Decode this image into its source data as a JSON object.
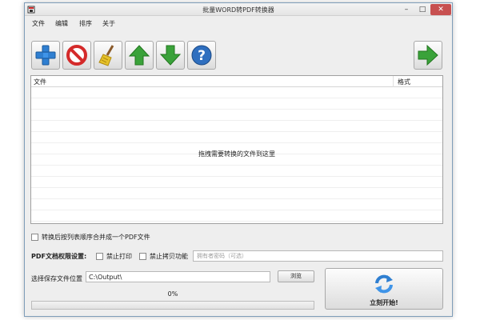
{
  "window": {
    "title": "批量WORD转PDF转换器",
    "min_glyph": "–",
    "max_glyph": "□",
    "close_glyph": "✕"
  },
  "menu": [
    "文件",
    "编辑",
    "排序",
    "关于"
  ],
  "toolbar": {
    "icons": [
      "add-icon",
      "remove-icon",
      "clear-broom-icon",
      "move-up-icon",
      "move-down-icon",
      "help-icon",
      "start-arrow-icon"
    ]
  },
  "file_list": {
    "columns": [
      "文件",
      "格式"
    ],
    "empty_hint": "拖拽需要转换的文件到这里"
  },
  "merge_option": {
    "label": "转换后按列表顺序合并成一个PDF文件",
    "checked": false
  },
  "permissions": {
    "label": "PDF文档权限设置:",
    "no_print": {
      "label": "禁止打印",
      "checked": false
    },
    "no_copy": {
      "label": "禁止拷贝功能",
      "checked": false
    },
    "owner_password_placeholder": "拥有者密码（可选）"
  },
  "save": {
    "label": "选择保存文件位置",
    "path": "C:\\Output\\",
    "browse_label": "浏览"
  },
  "progress": {
    "percent_text": "0%",
    "value": 0
  },
  "start": {
    "label": "立刻开始!",
    "icon": "refresh-icon"
  },
  "colors": {
    "accent_green": "#3aa23a",
    "accent_blue": "#2f7fd1",
    "danger_red": "#d42a2a",
    "close_red": "#c75050"
  }
}
